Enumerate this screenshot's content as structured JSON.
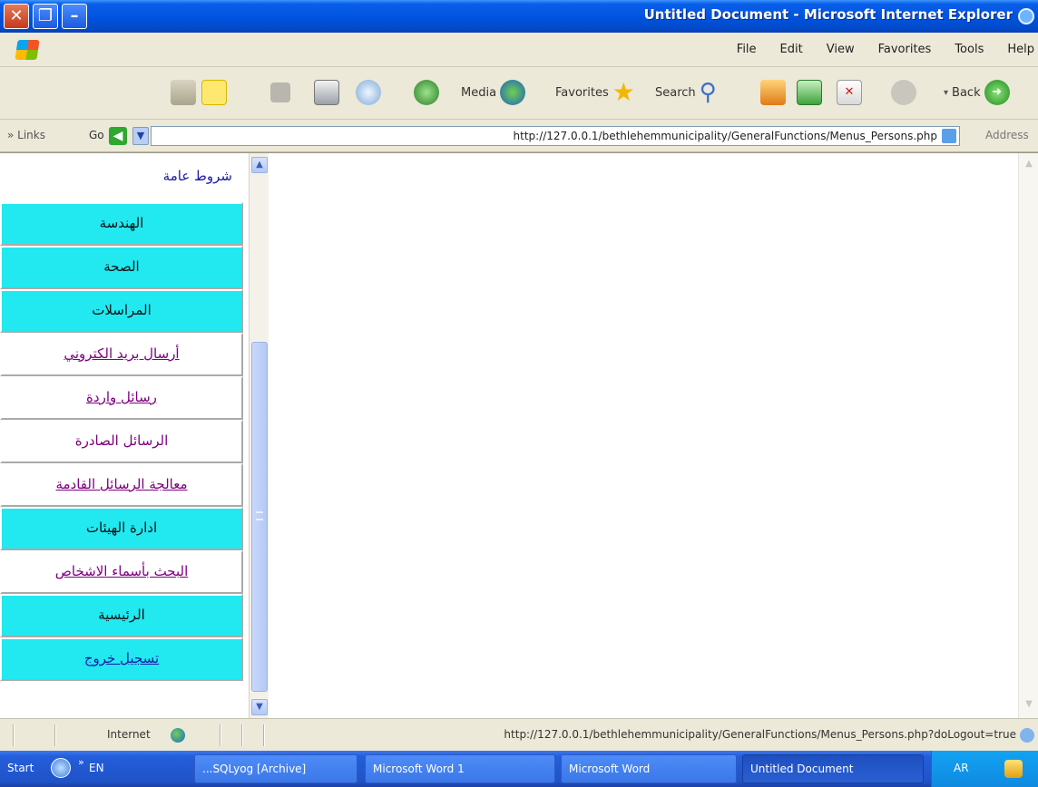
{
  "window": {
    "title": "Untitled Document - Microsoft Internet Explorer"
  },
  "menubar": {
    "items": [
      "Help",
      "Tools",
      "Favorites",
      "View",
      "Edit",
      "File"
    ]
  },
  "toolbar": {
    "media_label": "Media",
    "favorites_label": "Favorites",
    "search_label": "Search",
    "back_label": "Back"
  },
  "addressbar": {
    "links_label": "» Links",
    "go_label": "Go",
    "url": "http://127.0.0.1/bethlehemmunicipality/GeneralFunctions/Menus_Persons.php",
    "address_label": "Address"
  },
  "side_menu": {
    "items": [
      {
        "label": "شروط عامة",
        "style": "right"
      },
      {
        "label": "الهندسة",
        "style": "cyan"
      },
      {
        "label": "الصحة",
        "style": "cyan"
      },
      {
        "label": "المراسلات",
        "style": "cyan"
      },
      {
        "label": "أرسال بريد الكتروني",
        "style": "link"
      },
      {
        "label": "رسائل واردة",
        "style": "link"
      },
      {
        "label": "الرسائل الصادرة",
        "style": "white"
      },
      {
        "label": "معالجة الرسائل القادمة",
        "style": "link"
      },
      {
        "label": "ادارة الهيئات",
        "style": "cyan"
      },
      {
        "label": "البحث بأسماء الاشخاص",
        "style": "link"
      },
      {
        "label": "الرئيسية",
        "style": "cyan"
      },
      {
        "label": "تسجيل خروج",
        "style": "cyan-link"
      }
    ]
  },
  "statusbar": {
    "zone": "Internet",
    "url": "http://127.0.0.1/bethlehemmunicipality/GeneralFunctions/Menus_Persons.php?doLogout=true"
  },
  "taskbar": {
    "start_label": "Start",
    "lang": "EN",
    "tasks": [
      "...SQLyog [Archive]",
      "Microsoft Word 1",
      "Microsoft Word",
      "Untitled Document"
    ],
    "tray_lang": "AR"
  },
  "colors": {
    "titlebar": "#0054e3",
    "menu_cyan": "#22e8f0",
    "visited_link": "#800080",
    "plain_link": "#1a1aa8"
  }
}
